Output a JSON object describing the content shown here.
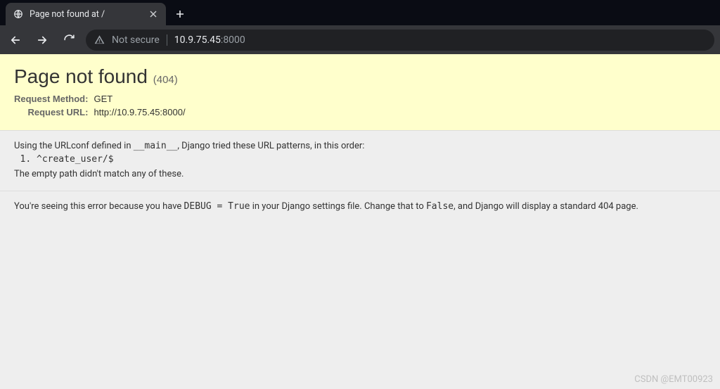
{
  "browser": {
    "tab_title": "Page not found at /",
    "not_secure_label": "Not secure",
    "url_host": "10.9.75.45",
    "url_port": ":8000"
  },
  "page": {
    "title": "Page not found",
    "status_code": "(404)",
    "request_method_label": "Request Method:",
    "request_method_value": "GET",
    "request_url_label": "Request URL:",
    "request_url_value": "http://10.9.75.45:8000/",
    "intro_prefix": "Using the URLconf defined in ",
    "intro_conf_module": "__main__",
    "intro_suffix": ", Django tried these URL patterns, in this order:",
    "patterns": [
      "^create_user/$"
    ],
    "no_match": "The empty path didn't match any of these.",
    "explain_prefix": "You're seeing this error because you have ",
    "explain_code1": "DEBUG = True",
    "explain_mid": " in your Django settings file. Change that to ",
    "explain_code2": "False",
    "explain_suffix": ", and Django will display a standard 404 page."
  },
  "watermark": "CSDN @EMT00923"
}
